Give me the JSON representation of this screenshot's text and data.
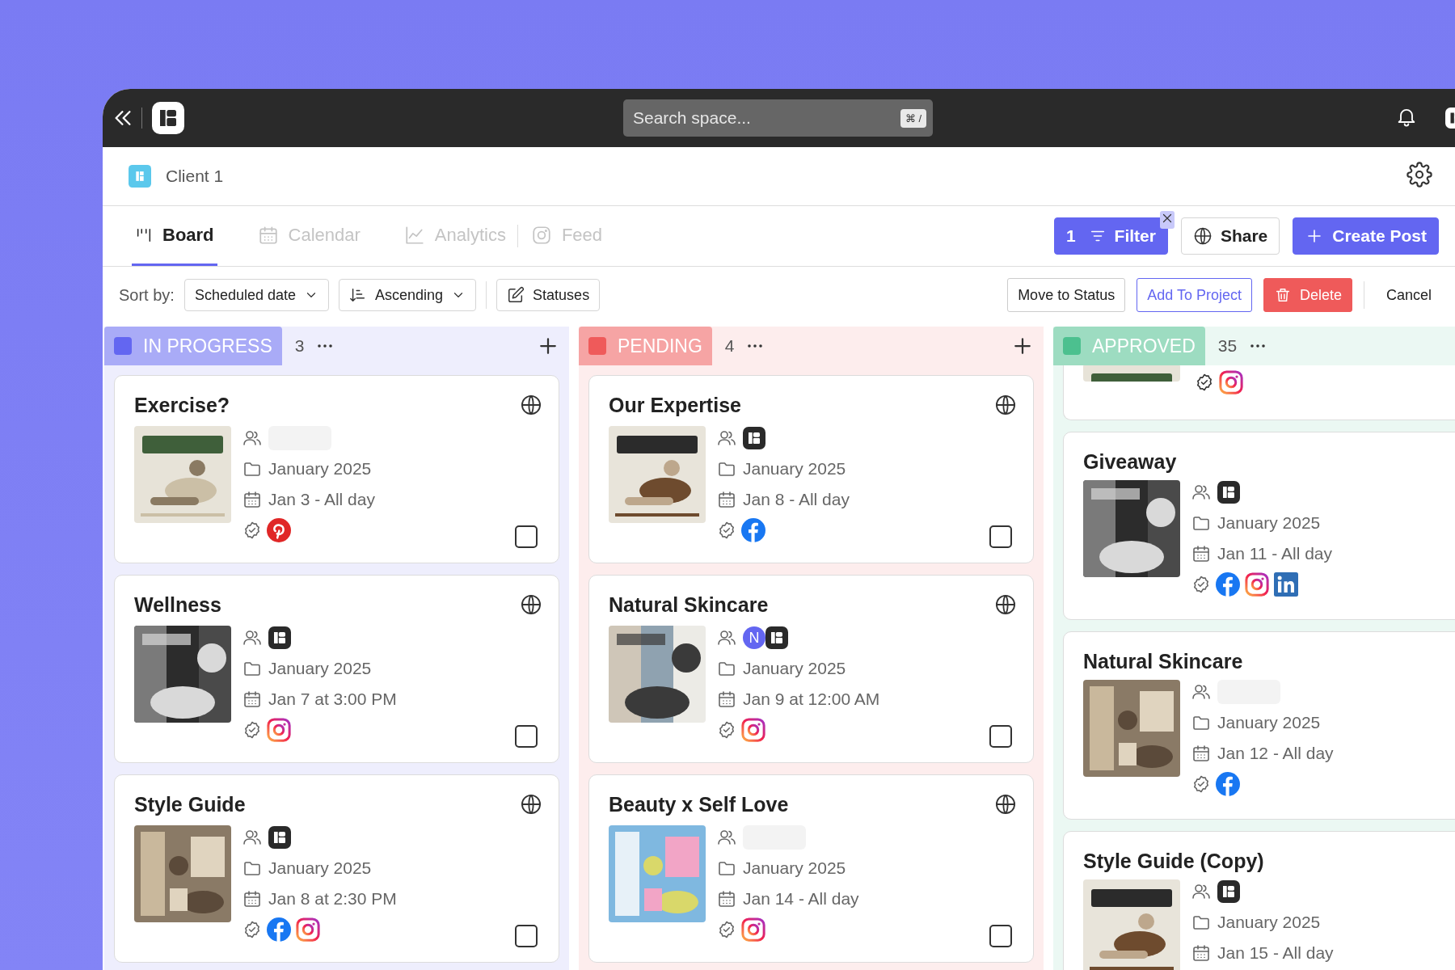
{
  "top_bar": {
    "search": {
      "placeholder": "Search space...",
      "shortcut": "⌘ /"
    }
  },
  "space": {
    "name": "Client 1"
  },
  "tabs": [
    {
      "label": "Board",
      "selected": true,
      "kind": "board"
    },
    {
      "label": "Calendar",
      "selected": false,
      "kind": "calendar"
    },
    {
      "label": "Analytics",
      "selected": false,
      "kind": "analytics"
    },
    {
      "label": "Feed",
      "selected": false,
      "kind": "feed"
    }
  ],
  "actions": {
    "filter_count": "1",
    "filter": "Filter",
    "share": "Share",
    "create": "Create Post"
  },
  "sort": {
    "label": "Sort by:",
    "field": "Scheduled date",
    "order": "Ascending",
    "statuses": "Statuses"
  },
  "bulk_actions": {
    "move": "Move to Status",
    "add": "Add To Project",
    "delete": "Delete",
    "cancel": "Cancel"
  },
  "columns": [
    {
      "name": "IN PROGRESS",
      "count": "3",
      "color": "#6366f1",
      "cards": [
        {
          "title": "Exercise?",
          "thumbnail": {
            "kind": "picture"
          },
          "project": "January 2025",
          "date": "Jan 3 - All day",
          "networks": [
            {
              "kind": "pinterest"
            }
          ],
          "selected": false
        },
        {
          "title": "Wellness",
          "thumbnail": {
            "kind": "picture"
          },
          "assignees": [
            {
              "kind": "logo"
            }
          ],
          "project": "January 2025",
          "date": "Jan 7 at 3:00 PM",
          "networks": [
            {
              "kind": "instagram"
            }
          ],
          "selected": false
        },
        {
          "title": "Style Guide",
          "thumbnail": {
            "kind": "picture"
          },
          "assignees": [
            {
              "kind": "logo"
            }
          ],
          "project": "January 2025",
          "date": "Jan 8 at 2:30 PM",
          "networks": [
            {
              "kind": "facebook"
            },
            {
              "kind": "instagram"
            }
          ],
          "selected": false
        }
      ]
    },
    {
      "name": "PENDING",
      "count": "4",
      "color": "#ef5a5a",
      "cards": [
        {
          "title": "Our Expertise",
          "thumbnail": {
            "kind": "picture"
          },
          "assignees": [
            {
              "kind": "logo"
            }
          ],
          "project": "January 2025",
          "date": "Jan 8 - All day",
          "networks": [
            {
              "kind": "facebook"
            }
          ],
          "selected": false
        },
        {
          "title": "Natural Skincare",
          "thumbnail": {
            "kind": "picture"
          },
          "assignees": [
            {
              "kind": "letter",
              "text": "N"
            },
            {
              "kind": "logo"
            }
          ],
          "project": "January 2025",
          "date": "Jan 9 at 12:00 AM",
          "networks": [
            {
              "kind": "instagram"
            }
          ],
          "selected": false
        },
        {
          "title": "Beauty x Self Love",
          "thumbnail": {
            "kind": "picture"
          },
          "project": "January 2025",
          "date": "Jan 14 - All day",
          "networks": [
            {
              "kind": "instagram"
            }
          ],
          "selected": false
        }
      ]
    },
    {
      "name": "APPROVED",
      "count": "35",
      "color": "#4cc08f",
      "cards": [
        {
          "kind": "partial",
          "networks": [
            {
              "kind": "instagram"
            }
          ]
        },
        {
          "title": "Giveaway",
          "thumbnail": {
            "kind": "picture"
          },
          "assignees": [
            {
              "kind": "logo"
            }
          ],
          "project": "January 2025",
          "date": "Jan 11 - All day",
          "networks": [
            {
              "kind": "facebook"
            },
            {
              "kind": "instagram"
            },
            {
              "kind": "linkedin"
            }
          ]
        },
        {
          "title": "Natural Skincare",
          "thumbnail": {
            "kind": "picture"
          },
          "project": "January 2025",
          "date": "Jan 12 - All day",
          "networks": [
            {
              "kind": "facebook"
            }
          ]
        },
        {
          "title": "Style Guide (Copy)",
          "thumbnail": {
            "kind": "picture"
          },
          "assignees": [
            {
              "kind": "logo"
            }
          ],
          "project": "January 2025",
          "date": "Jan 15 - All day"
        }
      ]
    }
  ]
}
